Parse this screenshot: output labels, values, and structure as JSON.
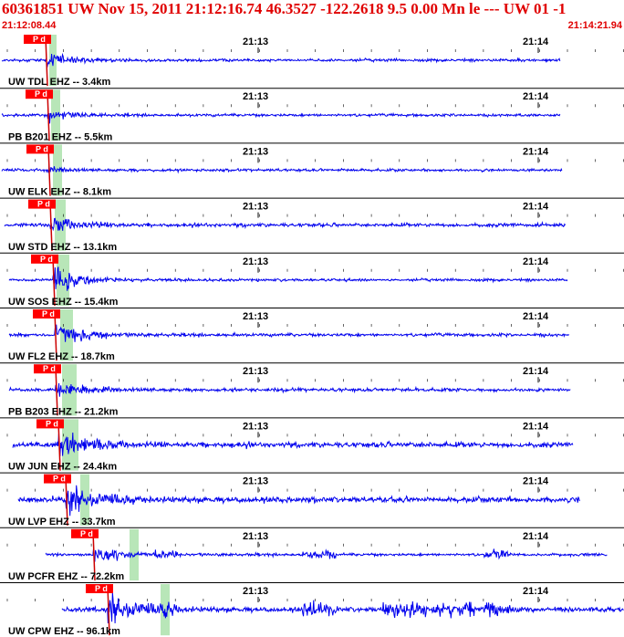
{
  "header": {
    "title": "60361851 UW Nov 15, 2011 21:12:16.74   46.3527 -122.2618  9.5 0.00 Mn le --- UW 01   -1",
    "start_time": "21:12:08.44",
    "end_time": "21:14:21.94"
  },
  "colors": {
    "title": "#e00000",
    "trace": "#0000ee",
    "pick_line": "#cc0000",
    "pick_box": "#ff0000",
    "window_band": "#b8e6b8",
    "tick": "#000000"
  },
  "time_marks": [
    "21:13",
    "21:14"
  ],
  "pick_label": "P d",
  "traces": [
    {
      "label": "UW TDL EHZ -- 3.4km",
      "amp": 0.22,
      "noise": 0.06
    },
    {
      "label": "PB B201 EHZ -- 5.5km",
      "amp": 0.2,
      "noise": 0.03
    },
    {
      "label": "UW ELK EHZ -- 8.1km",
      "amp": 0.1,
      "noise": 0.02
    },
    {
      "label": "UW STD EHZ -- 13.1km",
      "amp": 0.3,
      "noise": 0.12
    },
    {
      "label": "UW SOS EHZ -- 15.4km",
      "amp": 0.35,
      "noise": 0.05
    },
    {
      "label": "UW FL2 EHZ -- 18.7km",
      "amp": 0.4,
      "noise": 0.08
    },
    {
      "label": "PB B203 EHZ -- 21.2km",
      "amp": 0.3,
      "noise": 0.1
    },
    {
      "label": "UW JUN EHZ -- 24.4km",
      "amp": 0.5,
      "noise": 0.22
    },
    {
      "label": "UW LVP EHZ -- 33.7km",
      "amp": 0.55,
      "noise": 0.25
    },
    {
      "label": "UW PCFR EHZ -- 72.2km",
      "amp": 0.3,
      "noise": 0.03
    },
    {
      "label": "UW CPW EHZ -- 96.1km",
      "amp": 0.55,
      "noise": 0.2
    }
  ]
}
